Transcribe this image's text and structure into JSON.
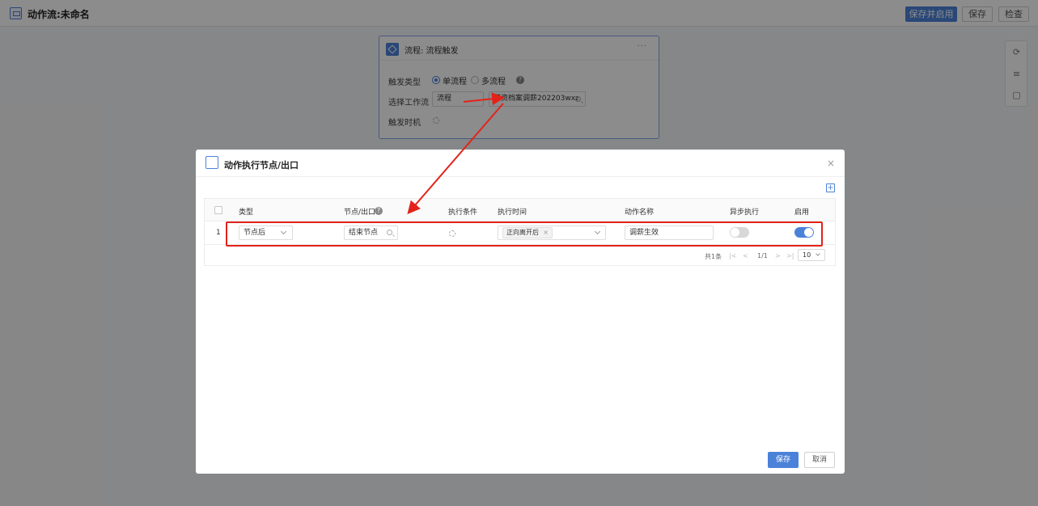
{
  "app": {
    "title": "动作流:未命名"
  },
  "toolbar": {
    "save_enable": "保存并启用",
    "save": "保存",
    "check": "检查"
  },
  "flow_card": {
    "title": "流程: 流程触发",
    "more": "···",
    "trigger_type_label": "触发类型",
    "radio_single": "单流程",
    "radio_multi": "多流程",
    "help": "?",
    "workflow_label": "选择工作流",
    "workflow_type": "流程",
    "workflow_name": "薪资档案调薪202203wxz",
    "timing_label": "触发时机"
  },
  "modal": {
    "title": "动作执行节点/出口",
    "close": "×",
    "add": "+",
    "columns": {
      "type": "类型",
      "node": "节点/出口",
      "condition": "执行条件",
      "time": "执行时间",
      "action_name": "动作名称",
      "async": "异步执行",
      "enable": "启用"
    },
    "rows": [
      {
        "index": "1",
        "type": "节点后",
        "node": "结束节点",
        "time_tag": "正向离开后",
        "tag_close": "×",
        "action_name": "调薪生效",
        "async": false,
        "enabled": true
      }
    ],
    "pager": {
      "total": "共1条",
      "first": "|<",
      "prev": "<",
      "current": "1/1",
      "next": ">",
      "last": ">|",
      "size": "10"
    },
    "save": "保存",
    "cancel": "取消"
  },
  "colors": {
    "accent": "#4b82d9",
    "annotation_red": "#e3231a"
  }
}
